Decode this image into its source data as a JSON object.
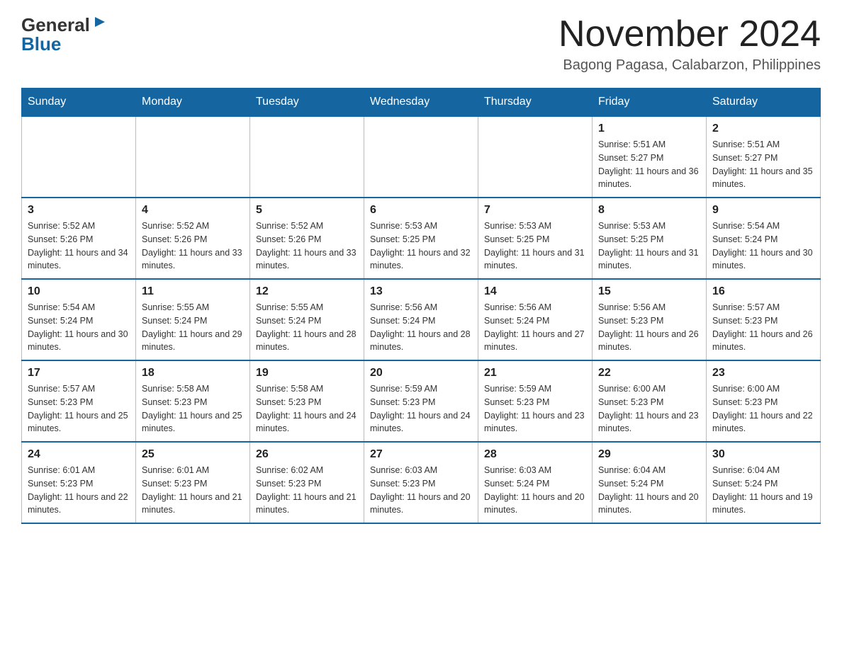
{
  "logo": {
    "general": "General",
    "blue": "Blue"
  },
  "title": "November 2024",
  "location": "Bagong Pagasa, Calabarzon, Philippines",
  "weekdays": [
    "Sunday",
    "Monday",
    "Tuesday",
    "Wednesday",
    "Thursday",
    "Friday",
    "Saturday"
  ],
  "weeks": [
    [
      {
        "day": "",
        "info": ""
      },
      {
        "day": "",
        "info": ""
      },
      {
        "day": "",
        "info": ""
      },
      {
        "day": "",
        "info": ""
      },
      {
        "day": "",
        "info": ""
      },
      {
        "day": "1",
        "info": "Sunrise: 5:51 AM\nSunset: 5:27 PM\nDaylight: 11 hours and 36 minutes."
      },
      {
        "day": "2",
        "info": "Sunrise: 5:51 AM\nSunset: 5:27 PM\nDaylight: 11 hours and 35 minutes."
      }
    ],
    [
      {
        "day": "3",
        "info": "Sunrise: 5:52 AM\nSunset: 5:26 PM\nDaylight: 11 hours and 34 minutes."
      },
      {
        "day": "4",
        "info": "Sunrise: 5:52 AM\nSunset: 5:26 PM\nDaylight: 11 hours and 33 minutes."
      },
      {
        "day": "5",
        "info": "Sunrise: 5:52 AM\nSunset: 5:26 PM\nDaylight: 11 hours and 33 minutes."
      },
      {
        "day": "6",
        "info": "Sunrise: 5:53 AM\nSunset: 5:25 PM\nDaylight: 11 hours and 32 minutes."
      },
      {
        "day": "7",
        "info": "Sunrise: 5:53 AM\nSunset: 5:25 PM\nDaylight: 11 hours and 31 minutes."
      },
      {
        "day": "8",
        "info": "Sunrise: 5:53 AM\nSunset: 5:25 PM\nDaylight: 11 hours and 31 minutes."
      },
      {
        "day": "9",
        "info": "Sunrise: 5:54 AM\nSunset: 5:24 PM\nDaylight: 11 hours and 30 minutes."
      }
    ],
    [
      {
        "day": "10",
        "info": "Sunrise: 5:54 AM\nSunset: 5:24 PM\nDaylight: 11 hours and 30 minutes."
      },
      {
        "day": "11",
        "info": "Sunrise: 5:55 AM\nSunset: 5:24 PM\nDaylight: 11 hours and 29 minutes."
      },
      {
        "day": "12",
        "info": "Sunrise: 5:55 AM\nSunset: 5:24 PM\nDaylight: 11 hours and 28 minutes."
      },
      {
        "day": "13",
        "info": "Sunrise: 5:56 AM\nSunset: 5:24 PM\nDaylight: 11 hours and 28 minutes."
      },
      {
        "day": "14",
        "info": "Sunrise: 5:56 AM\nSunset: 5:24 PM\nDaylight: 11 hours and 27 minutes."
      },
      {
        "day": "15",
        "info": "Sunrise: 5:56 AM\nSunset: 5:23 PM\nDaylight: 11 hours and 26 minutes."
      },
      {
        "day": "16",
        "info": "Sunrise: 5:57 AM\nSunset: 5:23 PM\nDaylight: 11 hours and 26 minutes."
      }
    ],
    [
      {
        "day": "17",
        "info": "Sunrise: 5:57 AM\nSunset: 5:23 PM\nDaylight: 11 hours and 25 minutes."
      },
      {
        "day": "18",
        "info": "Sunrise: 5:58 AM\nSunset: 5:23 PM\nDaylight: 11 hours and 25 minutes."
      },
      {
        "day": "19",
        "info": "Sunrise: 5:58 AM\nSunset: 5:23 PM\nDaylight: 11 hours and 24 minutes."
      },
      {
        "day": "20",
        "info": "Sunrise: 5:59 AM\nSunset: 5:23 PM\nDaylight: 11 hours and 24 minutes."
      },
      {
        "day": "21",
        "info": "Sunrise: 5:59 AM\nSunset: 5:23 PM\nDaylight: 11 hours and 23 minutes."
      },
      {
        "day": "22",
        "info": "Sunrise: 6:00 AM\nSunset: 5:23 PM\nDaylight: 11 hours and 23 minutes."
      },
      {
        "day": "23",
        "info": "Sunrise: 6:00 AM\nSunset: 5:23 PM\nDaylight: 11 hours and 22 minutes."
      }
    ],
    [
      {
        "day": "24",
        "info": "Sunrise: 6:01 AM\nSunset: 5:23 PM\nDaylight: 11 hours and 22 minutes."
      },
      {
        "day": "25",
        "info": "Sunrise: 6:01 AM\nSunset: 5:23 PM\nDaylight: 11 hours and 21 minutes."
      },
      {
        "day": "26",
        "info": "Sunrise: 6:02 AM\nSunset: 5:23 PM\nDaylight: 11 hours and 21 minutes."
      },
      {
        "day": "27",
        "info": "Sunrise: 6:03 AM\nSunset: 5:23 PM\nDaylight: 11 hours and 20 minutes."
      },
      {
        "day": "28",
        "info": "Sunrise: 6:03 AM\nSunset: 5:24 PM\nDaylight: 11 hours and 20 minutes."
      },
      {
        "day": "29",
        "info": "Sunrise: 6:04 AM\nSunset: 5:24 PM\nDaylight: 11 hours and 20 minutes."
      },
      {
        "day": "30",
        "info": "Sunrise: 6:04 AM\nSunset: 5:24 PM\nDaylight: 11 hours and 19 minutes."
      }
    ]
  ]
}
